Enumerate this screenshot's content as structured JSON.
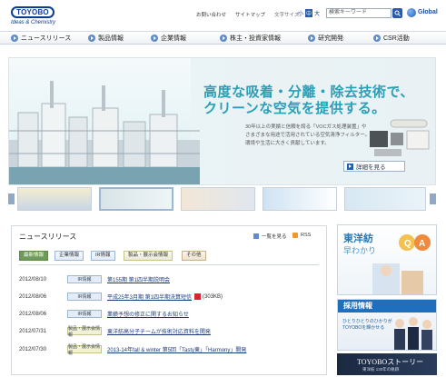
{
  "header": {
    "logo": "TOYOBO",
    "tagline": "Ideas & Chemistry",
    "links": [
      "お問い合わせ",
      "サイトマップ"
    ],
    "font_size_label": "文字サイズ",
    "font_sizes": [
      "小",
      "中",
      "大"
    ],
    "search_placeholder": "検索キーワード",
    "global_label": "Global"
  },
  "nav": {
    "items": [
      "ニュースリリース",
      "製品情報",
      "企業情報",
      "株主・投資家情報",
      "研究開発",
      "CSR活動"
    ]
  },
  "hero": {
    "headline1": "高度な吸着・分離・除去技術で、",
    "headline2": "クリーンな空気を提供する。",
    "desc1": "30年以上の実績と信頼を誇る「VOCガス処理装置」や",
    "desc2": "さまざまな用途で活用されている空気清浄フィルター。",
    "desc3": "環境や生活に大きく貢献しています。",
    "detail_button": "詳細を見る"
  },
  "news": {
    "title": "ニュースリリース",
    "more_label": "一覧を見る",
    "rss_label": "RSS",
    "tabs": [
      "最新情報",
      "企業情報",
      "IR情報",
      "製品・展示会情報",
      "その他"
    ],
    "items": [
      {
        "date": "2012/08/10",
        "badge": "IR情報",
        "title": "第155期 第1四半期説明会"
      },
      {
        "date": "2012/08/06",
        "badge": "IR情報",
        "title": "平成25年3月期 第1四半期決算短信",
        "size": "(303KB)"
      },
      {
        "date": "2012/08/06",
        "badge": "IR情報",
        "title": "業績予想の修正に関するお知らせ"
      },
      {
        "date": "2012/07/31",
        "badge": "製品・展示会情報",
        "title": "東洋紡高分子チームが技術対応資料を開発"
      },
      {
        "date": "2012/07/30",
        "badge": "製品・展示会情報",
        "title": "2013-14年fall & winter 第5回「Tasty東」「Harmony」開発"
      }
    ]
  },
  "side": {
    "banner1_title": "東洋紡",
    "banner1_sub": "早わかり",
    "banner1_qa": "Q&A",
    "banner2_title": "採用情報",
    "banner2_l1": "ひとりひとりのひかりが",
    "banner2_l2": "TOYOBOを輝かせる",
    "banner2_l3": "",
    "banner3_title": "TOYOBOストーリー",
    "banner3_sub": "東洋紡 130年の軌跡"
  },
  "colors": {
    "brand_blue": "#0a3d8f",
    "hero_teal": "#2a9fb8",
    "link_blue": "#1b3a7a"
  }
}
